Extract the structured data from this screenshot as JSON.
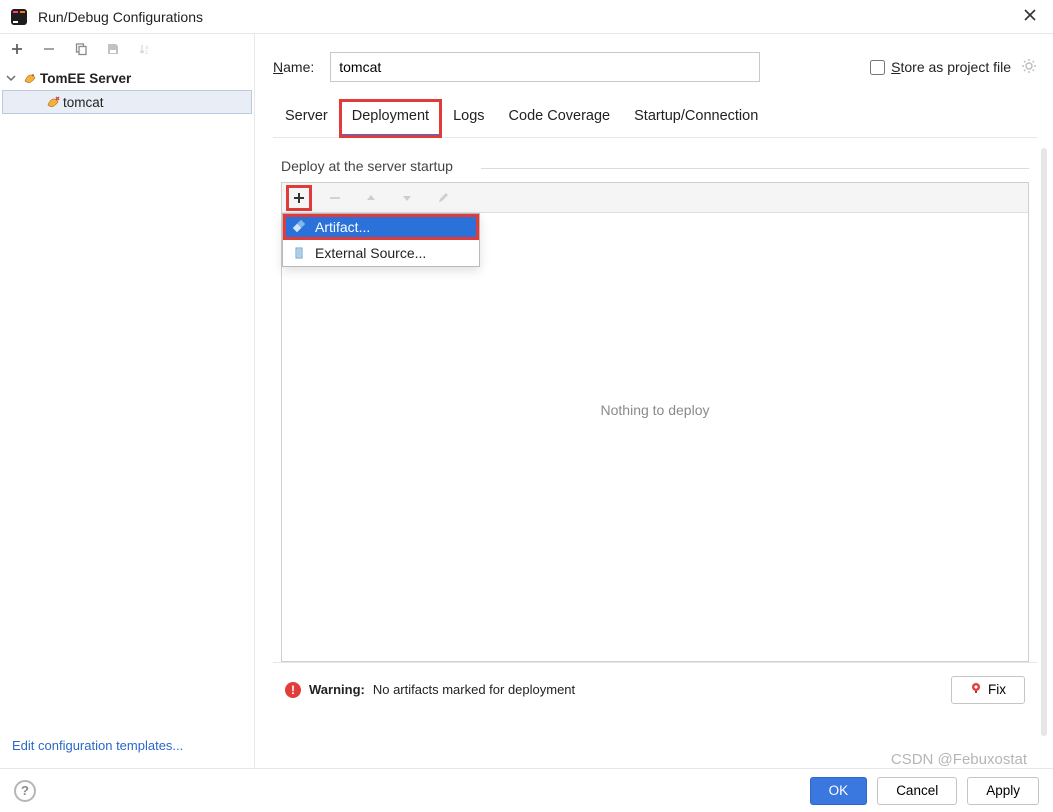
{
  "window": {
    "title": "Run/Debug Configurations"
  },
  "left": {
    "tree": {
      "folder_label": "TomEE Server",
      "item_label": "tomcat"
    },
    "edit_templates": "Edit configuration templates..."
  },
  "form": {
    "name_label_prefix": "N",
    "name_label_rest": "ame:",
    "name_value": "tomcat",
    "store_label_prefix": "S",
    "store_label_rest": "tore as project file"
  },
  "tabs": [
    {
      "label": "Server"
    },
    {
      "label": "Deployment"
    },
    {
      "label": "Logs"
    },
    {
      "label": "Code Coverage"
    },
    {
      "label": "Startup/Connection"
    }
  ],
  "deploy": {
    "section_title": "Deploy at the server startup",
    "placeholder": "Nothing to deploy",
    "dropdown": [
      {
        "label": "Artifact..."
      },
      {
        "label": "External Source..."
      }
    ]
  },
  "warning": {
    "title": "Warning:",
    "text": "No artifacts marked for deployment",
    "fix_label": "Fix"
  },
  "footer": {
    "ok": "OK",
    "cancel": "Cancel",
    "apply": "Apply"
  },
  "watermark": "CSDN @Febuxostat"
}
